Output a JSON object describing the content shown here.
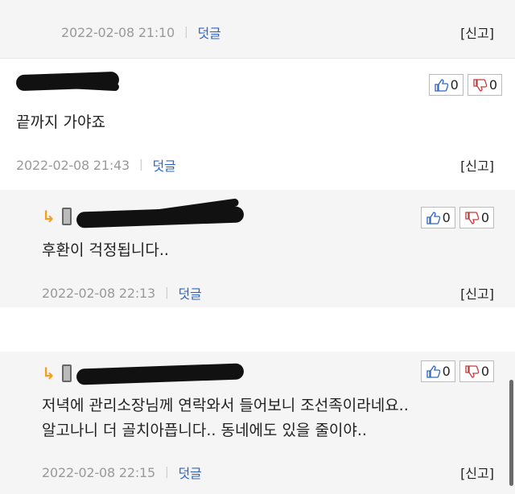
{
  "comments": [
    {
      "timestamp": "2022-02-08 21:10",
      "reply_label": "덧글",
      "report_label": "[신고]"
    },
    {
      "text_lines": [
        "끝까지 가야죠"
      ],
      "timestamp": "2022-02-08 21:43",
      "reply_label": "덧글",
      "report_label": "[신고]",
      "upvotes": "0",
      "downvotes": "0"
    },
    {
      "text_lines": [
        "후환이 걱정됩니다.."
      ],
      "timestamp": "2022-02-08 22:13",
      "reply_label": "덧글",
      "report_label": "[신고]",
      "upvotes": "0",
      "downvotes": "0"
    },
    {
      "text_lines": [
        "저녁에 관리소장님께 연락와서 들어보니 조선족이라네요..",
        "알고나니 더 골치아픕니다.. 동네에도 있을 줄이야.."
      ],
      "timestamp": "2022-02-08 22:15",
      "reply_label": "덧글",
      "report_label": "[신고]",
      "upvotes": "0",
      "downvotes": "0"
    }
  ],
  "icons": {
    "thumb_up": "thumbs-up-icon",
    "thumb_down": "thumbs-down-icon",
    "reply_arrow": "reply-arrow-icon",
    "device": "mobile-device-icon"
  },
  "colors": {
    "reply_link": "#2f63c4",
    "arrow": "#f0a020",
    "gray_bg": "#f5f5f5"
  }
}
